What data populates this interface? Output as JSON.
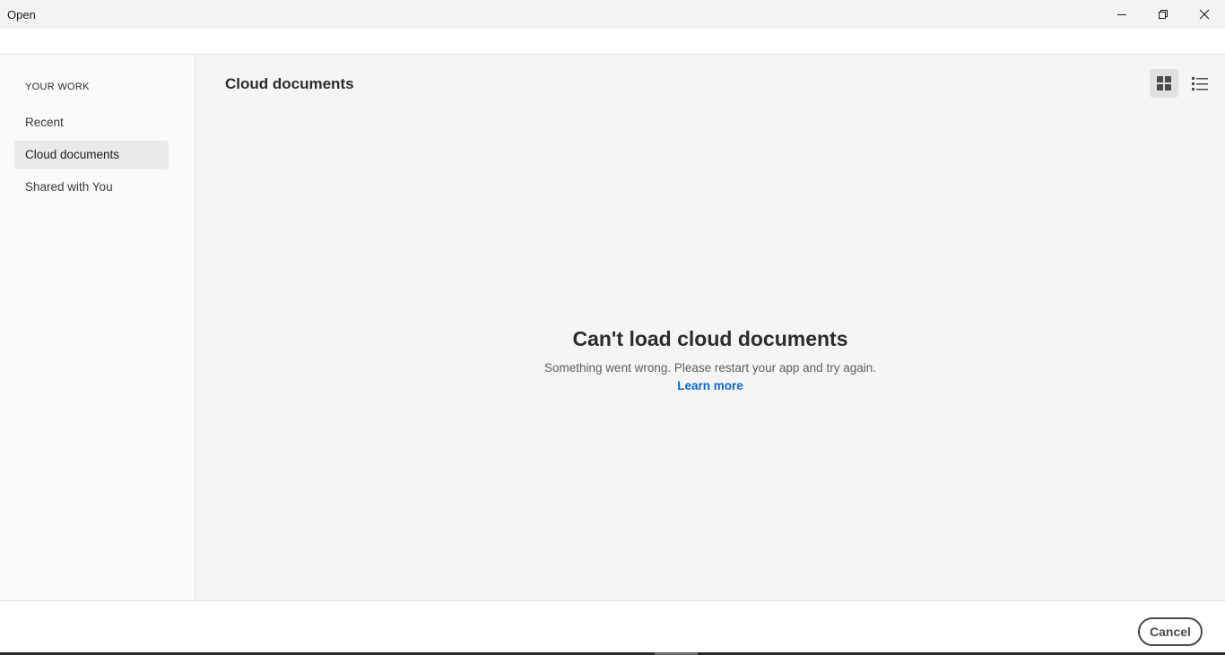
{
  "window": {
    "title": "Open"
  },
  "sidebar": {
    "section_heading": "YOUR WORK",
    "items": [
      {
        "label": "Recent",
        "selected": false
      },
      {
        "label": "Cloud documents",
        "selected": true
      },
      {
        "label": "Shared with You",
        "selected": false
      }
    ]
  },
  "main": {
    "title": "Cloud documents",
    "view_modes": [
      "grid-icon",
      "list-icon"
    ],
    "active_view": "grid",
    "empty_state": {
      "title": "Can't load cloud documents",
      "description": "Something went wrong. Please restart your app and try again.",
      "link": "Learn more"
    }
  },
  "footer": {
    "cancel_label": "Cancel"
  },
  "colors": {
    "accent_link": "#0d66d0",
    "selected_item_bg": "#eaeaea",
    "main_bg": "#f5f5f5"
  }
}
